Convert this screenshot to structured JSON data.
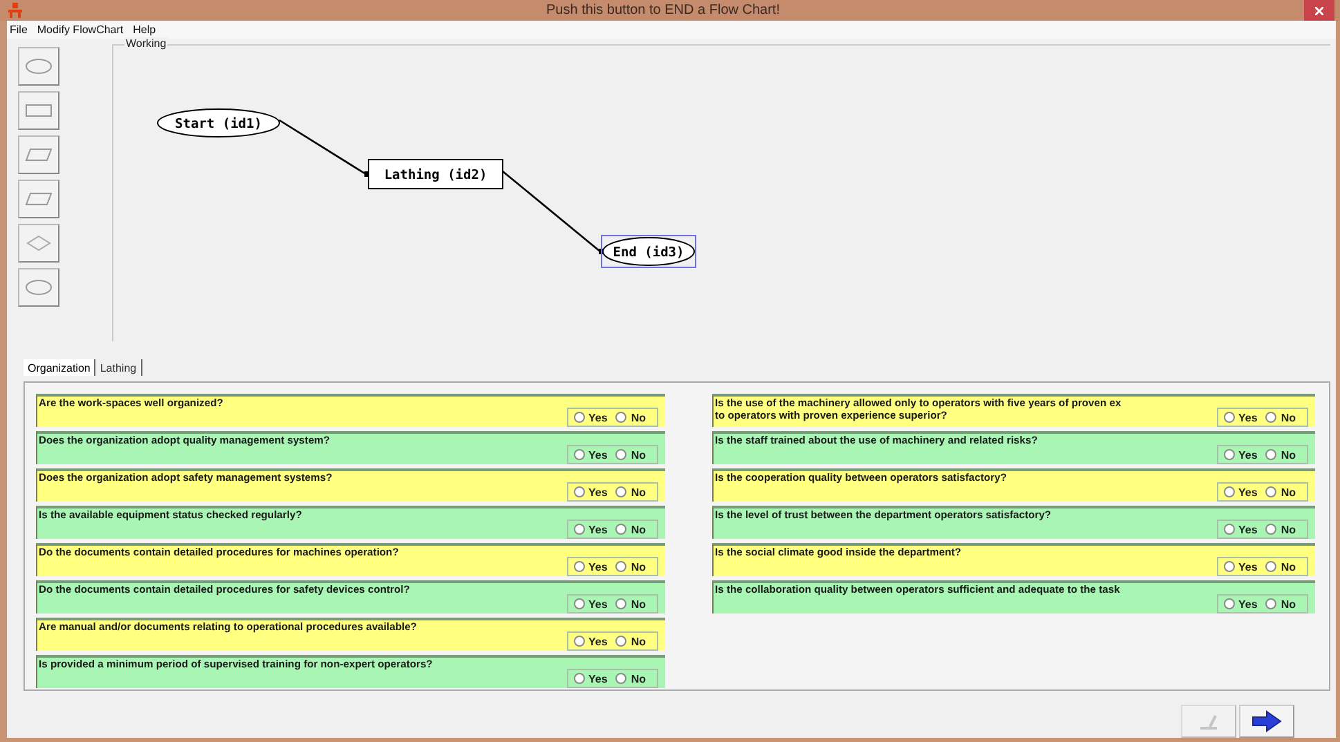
{
  "window": {
    "title": "Push this button to END a Flow Chart!"
  },
  "menu": [
    "File",
    "Modify FlowChart",
    "Help"
  ],
  "tools": [
    {
      "kind": "ellipse"
    },
    {
      "kind": "rect"
    },
    {
      "kind": "para"
    },
    {
      "kind": "para"
    },
    {
      "kind": "diamond"
    },
    {
      "kind": "ellipse"
    }
  ],
  "canvas": {
    "label": "Working",
    "nodes": [
      {
        "label": "Start (id1)",
        "kind": "ellipse",
        "selected": false
      },
      {
        "label": "Lathing (id2)",
        "kind": "rect",
        "selected": false
      },
      {
        "label": "End (id3)",
        "kind": "ellipse",
        "selected": true
      }
    ]
  },
  "tabs": [
    {
      "label": "Organization",
      "selected": true
    },
    {
      "label": "Lathing",
      "selected": false
    }
  ],
  "questions_left": [
    {
      "text": "Are the work-spaces  well organized?",
      "color": "#ffff80",
      "options": [
        {
          "label": "Yes",
          "selected": false
        },
        {
          "label": "No",
          "selected": false
        }
      ]
    },
    {
      "text": "Does the organization adopt quality management system?",
      "color": "#a8f5b4",
      "options": [
        {
          "label": "Yes",
          "selected": false
        },
        {
          "label": "No",
          "selected": false
        }
      ]
    },
    {
      "text": "Does the organization adopt safety management systems?",
      "color": "#ffff80",
      "options": [
        {
          "label": "Yes",
          "selected": false
        },
        {
          "label": "No",
          "selected": false
        }
      ]
    },
    {
      "text": "Is the available equipment status checked regularly?",
      "color": "#a8f5b4",
      "options": [
        {
          "label": "Yes",
          "selected": false
        },
        {
          "label": "No",
          "selected": false
        }
      ]
    },
    {
      "text": "Do the documents contain detailed procedures for machines operation?",
      "color": "#ffff80",
      "options": [
        {
          "label": "Yes",
          "selected": false
        },
        {
          "label": "No",
          "selected": false
        }
      ]
    },
    {
      "text": "Do the documents contain detailed procedures for safety devices control?",
      "color": "#a8f5b4",
      "options": [
        {
          "label": "Yes",
          "selected": false
        },
        {
          "label": "No",
          "selected": false
        }
      ]
    },
    {
      "text": "Are manual and/or documents relating to operational procedures available?",
      "color": "#ffff80",
      "options": [
        {
          "label": "Yes",
          "selected": false
        },
        {
          "label": "No",
          "selected": false
        }
      ]
    },
    {
      "text": "Is provided a minimum period of supervised training for non-expert operators?",
      "color": "#a8f5b4",
      "options": [
        {
          "label": "Yes",
          "selected": false
        },
        {
          "label": "No",
          "selected": false
        }
      ]
    }
  ],
  "questions_right": [
    {
      "text": "Is the use of the machinery allowed only to operators with five years of proven ex",
      "text_2": "to operators with proven experience superior?",
      "color": "#ffff80",
      "options": [
        {
          "label": "Yes",
          "selected": false
        },
        {
          "label": "No",
          "selected": false
        }
      ]
    },
    {
      "text": "Is the staff trained about the use of machinery and related risks?",
      "color": "#a8f5b4",
      "options": [
        {
          "label": "Yes",
          "selected": false
        },
        {
          "label": "No",
          "selected": false
        }
      ]
    },
    {
      "text": "Is the cooperation quality between operators satisfactory?",
      "color": "#ffff80",
      "options": [
        {
          "label": "Yes",
          "selected": false
        },
        {
          "label": "No",
          "selected": false
        }
      ]
    },
    {
      "text": "Is the level of trust between the department operators satisfactory?",
      "color": "#a8f5b4",
      "options": [
        {
          "label": "Yes",
          "selected": false
        },
        {
          "label": "No",
          "selected": false
        }
      ]
    },
    {
      "text": "Is the social climate good inside the department?",
      "color": "#ffff80",
      "options": [
        {
          "label": "Yes",
          "selected": false
        },
        {
          "label": "No",
          "selected": false
        }
      ]
    },
    {
      "text": "Is the collaboration quality between operators sufficient and adequate to the task",
      "color": "#a8f5b4",
      "options": [
        {
          "label": "Yes",
          "selected": false
        },
        {
          "label": "No",
          "selected": false
        }
      ]
    }
  ],
  "footer_buttons": [
    {
      "kind": "edit",
      "disabled": true
    },
    {
      "kind": "next",
      "disabled": false
    }
  ]
}
